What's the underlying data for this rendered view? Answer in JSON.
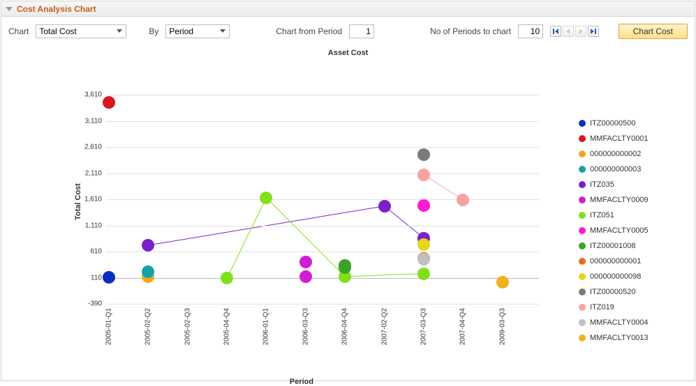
{
  "panel": {
    "title": "Cost Analysis Chart"
  },
  "controls": {
    "chart_label": "Chart",
    "chart_value": "Total Cost",
    "by_label": "By",
    "by_value": "Period",
    "from_label": "Chart from Period",
    "from_value": "1",
    "periods_label": "No of Periods to chart",
    "periods_value": "10",
    "button_label": "Chart Cost"
  },
  "chart_data": {
    "type": "scatter",
    "title": "Asset Cost",
    "xlabel": "Period",
    "ylabel": "Total Cost",
    "ylim": [
      -390,
      3610
    ],
    "y_ticks": [
      -390,
      110,
      610,
      1110,
      1610,
      2110,
      2610,
      3110,
      3610
    ],
    "categories": [
      "2005-01-Q1",
      "2005-02-Q2",
      "2005-02-Q3",
      "2005-04-Q4",
      "2006-01-Q1",
      "2006-03-Q3",
      "2006-04-Q4",
      "2007-02-Q2",
      "2007-03-Q3",
      "2007-04-Q4",
      "2009-03-Q3"
    ],
    "series": [
      {
        "name": "ITZ00000500",
        "color": "#0a2fbf",
        "points": [
          {
            "x": "2005-01-Q1",
            "y": 120
          }
        ]
      },
      {
        "name": "MMFACLTY0001",
        "color": "#d9171e",
        "points": [
          {
            "x": "2005-01-Q1",
            "y": 3470
          }
        ]
      },
      {
        "name": "000000000002",
        "color": "#f2a71b",
        "points": [
          {
            "x": "2005-02-Q2",
            "y": 130
          }
        ]
      },
      {
        "name": "000000000003",
        "color": "#13a3a3",
        "points": [
          {
            "x": "2005-02-Q2",
            "y": 230
          }
        ]
      },
      {
        "name": "ITZ035",
        "color": "#7b1fc9",
        "points": [
          {
            "x": "2005-02-Q2",
            "y": 730
          },
          {
            "x": "2007-02-Q2",
            "y": 1480
          },
          {
            "x": "2007-03-Q3",
            "y": 870
          }
        ]
      },
      {
        "name": "MMFACLTY0009",
        "color": "#d41bd4",
        "points": [
          {
            "x": "2006-03-Q3",
            "y": 410
          },
          {
            "x": "2006-03-Q3",
            "y": 130
          }
        ]
      },
      {
        "name": "ITZ051",
        "color": "#82e01b",
        "points": [
          {
            "x": "2005-04-Q4",
            "y": 100
          },
          {
            "x": "2006-01-Q1",
            "y": 1640
          },
          {
            "x": "2006-04-Q4",
            "y": 130
          },
          {
            "x": "2007-03-Q3",
            "y": 190
          }
        ]
      },
      {
        "name": "MMFACLTY0005",
        "color": "#ff1bd4",
        "points": [
          {
            "x": "2007-03-Q3",
            "y": 1490
          }
        ]
      },
      {
        "name": "ITZ00001008",
        "color": "#3aa323",
        "points": [
          {
            "x": "2006-04-Q4",
            "y": 340
          },
          {
            "x": "2006-04-Q4",
            "y": 310
          }
        ]
      },
      {
        "name": "000000000001",
        "color": "#e86b1b",
        "points": [
          {
            "x": "2007-03-Q3",
            "y": 480
          }
        ]
      },
      {
        "name": "000000000098",
        "color": "#e8d41b",
        "points": [
          {
            "x": "2007-03-Q3",
            "y": 740
          }
        ]
      },
      {
        "name": "ITZ00000520",
        "color": "#7a7a7a",
        "points": [
          {
            "x": "2007-03-Q3",
            "y": 2460
          }
        ]
      },
      {
        "name": "ITZ019",
        "color": "#f7a3a3",
        "points": [
          {
            "x": "2007-03-Q3",
            "y": 2080
          },
          {
            "x": "2007-04-Q4",
            "y": 1600
          }
        ]
      },
      {
        "name": "MMFACLTY0004",
        "color": "#bfbfbf",
        "points": [
          {
            "x": "2007-03-Q3",
            "y": 470
          }
        ]
      },
      {
        "name": "MMFACLTY0013",
        "color": "#f2b21b",
        "points": [
          {
            "x": "2009-03-Q3",
            "y": 30
          }
        ]
      }
    ],
    "point_radius": 9
  }
}
